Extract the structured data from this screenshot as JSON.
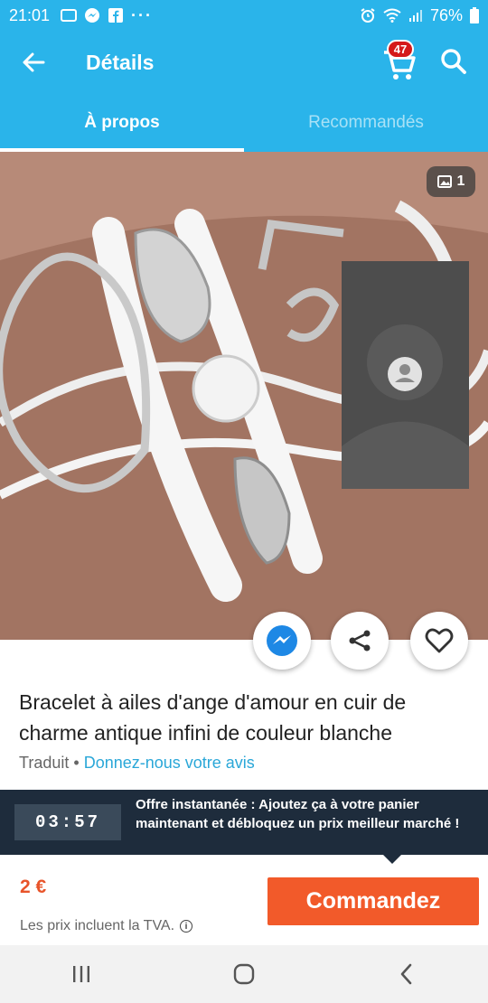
{
  "status_bar": {
    "time": "21:01",
    "battery": "76%",
    "dots": "···",
    "icons": [
      "image-icon",
      "messenger-icon",
      "facebook-icon",
      "alarm-icon",
      "wifi-icon",
      "signal-icon",
      "battery-icon"
    ]
  },
  "header": {
    "title": "Détails",
    "cart_count": "47"
  },
  "tabs": [
    {
      "label": "À propos",
      "active": true
    },
    {
      "label": "Recommandés",
      "active": false
    }
  ],
  "image": {
    "counter": "1"
  },
  "product": {
    "title": "Bracelet à ailes d'ange d'amour en cuir de charme antique infini de couleur blanche",
    "translated_label": "Traduit",
    "separator": "•",
    "feedback_link": "Donnez-nous votre avis"
  },
  "offer": {
    "timer": "03:57",
    "text": "Offre instantanée : Ajoutez ça à votre panier maintenant et débloquez un prix meilleur marché !"
  },
  "price": {
    "value": "2 €",
    "vat_note": "Les prix incluent la TVA."
  },
  "order_button": "Commandez",
  "colors": {
    "primary": "#2ab4ea",
    "accent": "#f25a2a",
    "badge": "#d51a1a",
    "banner": "#1e2c3c"
  }
}
